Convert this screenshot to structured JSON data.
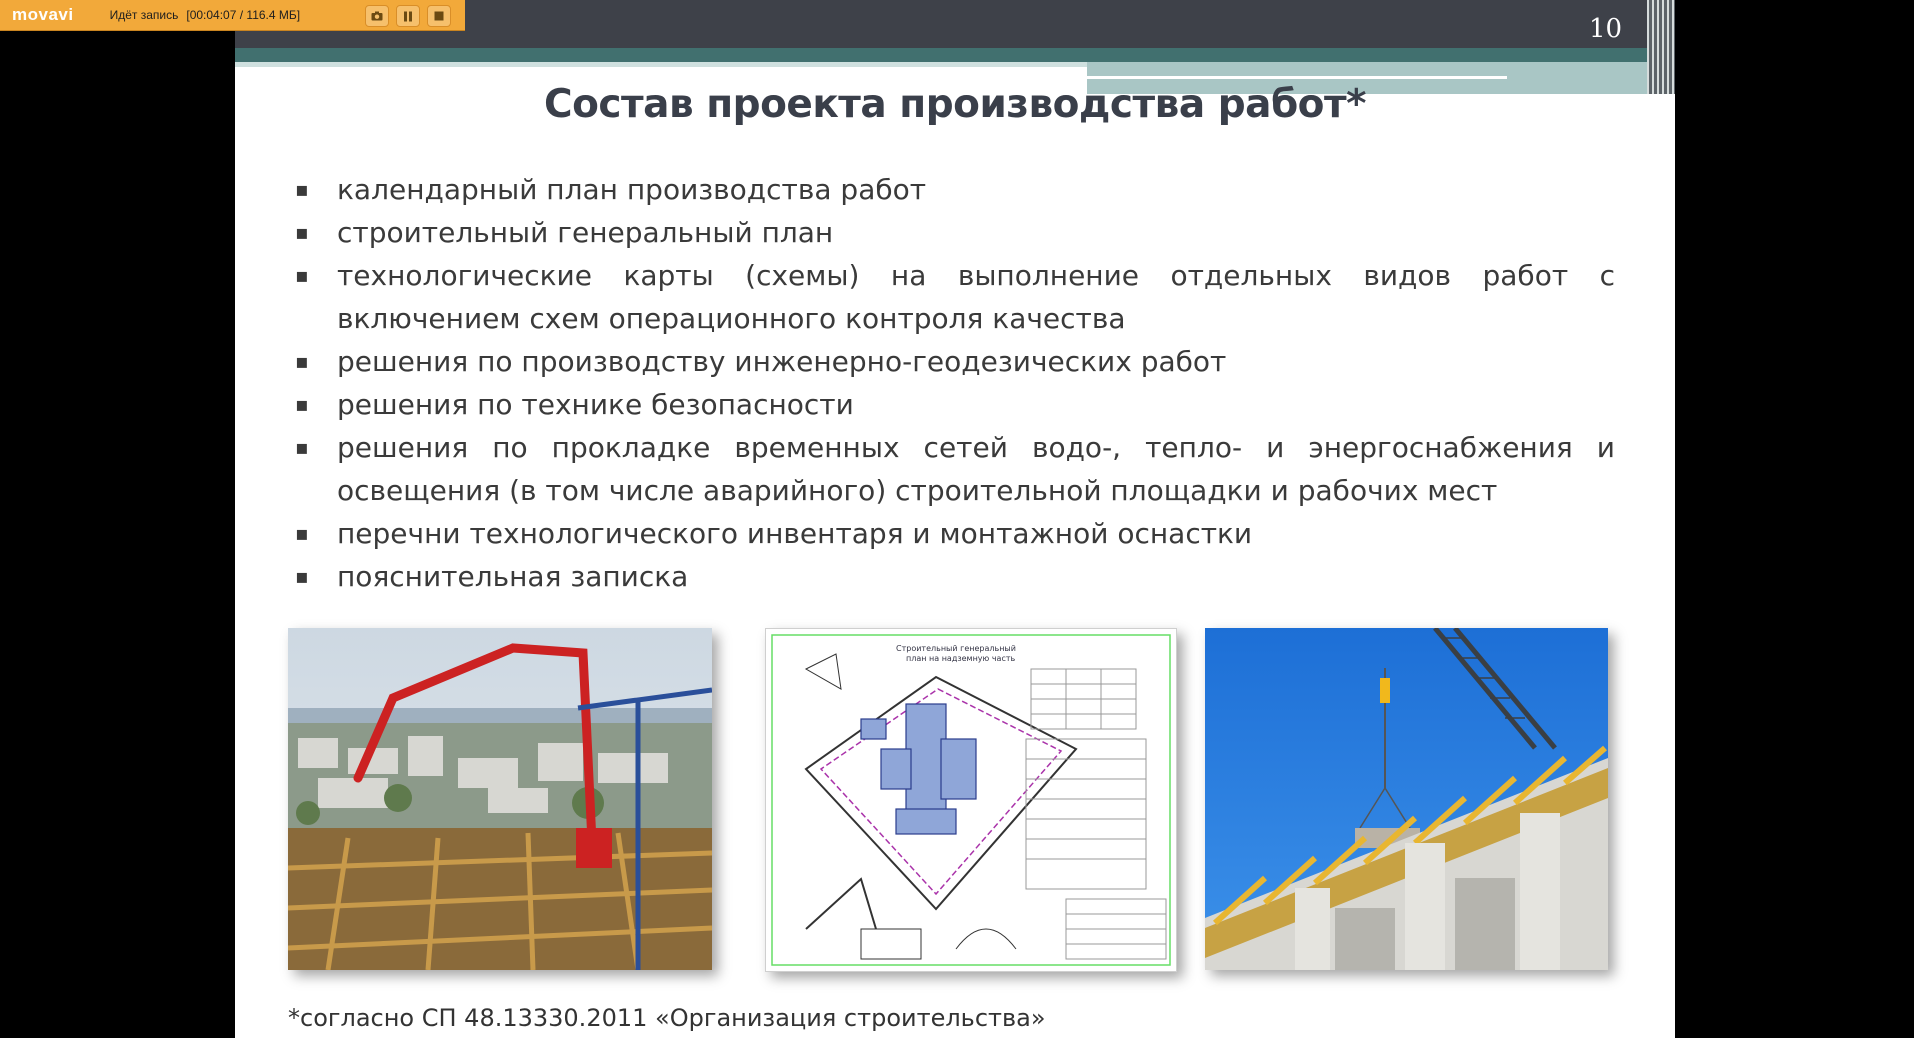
{
  "recorder": {
    "logo": "movavi",
    "status": "Идёт запись",
    "time": "[00:04:07 / 116.4 МБ]",
    "buttons": [
      "screenshot-icon",
      "pause-icon",
      "stop-icon"
    ]
  },
  "slide": {
    "number": "10",
    "title": "Состав проекта производства работ*",
    "bullet_marker": "▪",
    "bullets": [
      "календарный план производства работ",
      "строительный генеральный план",
      "технологические карты (схемы) на выполнение отдельных видов работ с включением схем операционного контроля качества",
      "решения по производству инженерно-геодезических работ",
      "решения по технике безопасности",
      "решения по прокладке временных сетей водо-, тепло- и энергоснабжения и освещения (в том числе аварийного) строительной площадки и рабочих мест",
      "перечни технологического инвентаря и монтажной оснастки",
      "пояснительная записка"
    ],
    "drawing_caption": "Строительный генеральный план на надземную часть",
    "footnote": "*согласно СП 48.13330.2011 «Организация строительства»"
  },
  "colors": {
    "recorder_bar": "#f2a93a",
    "slide_header_dark": "#3e4149",
    "slide_header_teal": "#41706f",
    "title_text": "#3a3f4a"
  }
}
